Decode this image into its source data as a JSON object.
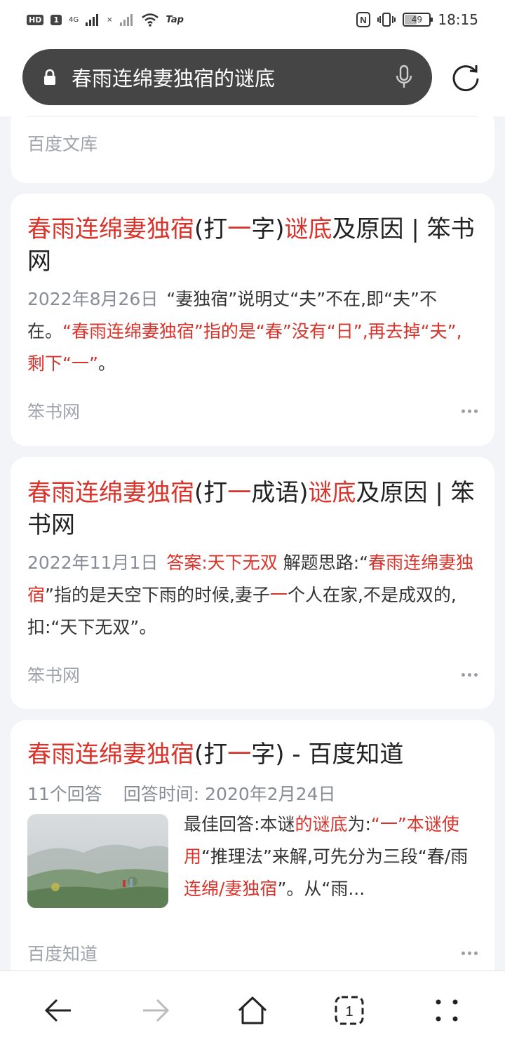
{
  "status_bar": {
    "hd": "HD",
    "sim": "1",
    "net_1": "4G",
    "net_2": "×",
    "tap": "Tap",
    "nfc": "N",
    "battery": "49",
    "battery_fraction": 0.49,
    "time": "18:15"
  },
  "search": {
    "query": "春雨连绵妻独宿的谜底"
  },
  "results": [
    {
      "source": "百度文库"
    },
    {
      "title": [
        {
          "t": "春雨连绵妻独宿",
          "hl": true
        },
        {
          "t": "(打",
          "hl": false
        },
        {
          "t": "一",
          "hl": true
        },
        {
          "t": "字)",
          "hl": false
        },
        {
          "t": "谜底",
          "hl": true
        },
        {
          "t": "及原因 | 笨书网",
          "hl": false
        }
      ],
      "date": "2022年8月26日",
      "snippet": [
        {
          "t": "“妻独宿”说明丈“夫”不在,即“夫”不在。",
          "hl": false
        },
        {
          "t": "“春雨连绵妻独宿”指的是“春”没有“日”,再去掉“夫”,剩下“一”",
          "hl": true
        },
        {
          "t": "。",
          "hl": false
        }
      ],
      "source": "笨书网"
    },
    {
      "title": [
        {
          "t": "春雨连绵妻独宿",
          "hl": true
        },
        {
          "t": "(打",
          "hl": false
        },
        {
          "t": "一",
          "hl": true
        },
        {
          "t": "成语)",
          "hl": false
        },
        {
          "t": "谜底",
          "hl": true
        },
        {
          "t": "及原因 | 笨书网",
          "hl": false
        }
      ],
      "date": "2022年11月1日",
      "snippet": [
        {
          "t": "答案:天下无双",
          "hl": true
        },
        {
          "t": " 解题思路:“",
          "hl": false
        },
        {
          "t": "春雨连绵妻独宿",
          "hl": true
        },
        {
          "t": "”指的是天空下雨的时候,妻子",
          "hl": false
        },
        {
          "t": "一",
          "hl": true
        },
        {
          "t": "个人在家,不是成双的,扣:“天下无双”。",
          "hl": false
        }
      ],
      "source": "笨书网"
    },
    {
      "title": [
        {
          "t": "春雨连绵妻独宿",
          "hl": true
        },
        {
          "t": "(打",
          "hl": false
        },
        {
          "t": "一",
          "hl": true
        },
        {
          "t": "字) - 百度知道",
          "hl": false
        }
      ],
      "answers": "11个回答",
      "answer_time": "回答时间:  2020年2月24日",
      "answer": [
        {
          "t": "最佳回答:本谜",
          "hl": false
        },
        {
          "t": "的谜底",
          "hl": true
        },
        {
          "t": "为:",
          "hl": false
        },
        {
          "t": "“一”本谜使用",
          "hl": true
        },
        {
          "t": "“推理法”来解,可先分为三段“春/雨",
          "hl": false
        },
        {
          "t": "连绵/妻独宿",
          "hl": true
        },
        {
          "t": "”。从“雨...",
          "hl": false
        }
      ],
      "source": "百度知道"
    }
  ],
  "nav": {
    "tab_count": "1"
  },
  "colors": {
    "highlight": "#d9342b",
    "search_bar": "#454545",
    "page_bg": "#f3f4f8"
  }
}
